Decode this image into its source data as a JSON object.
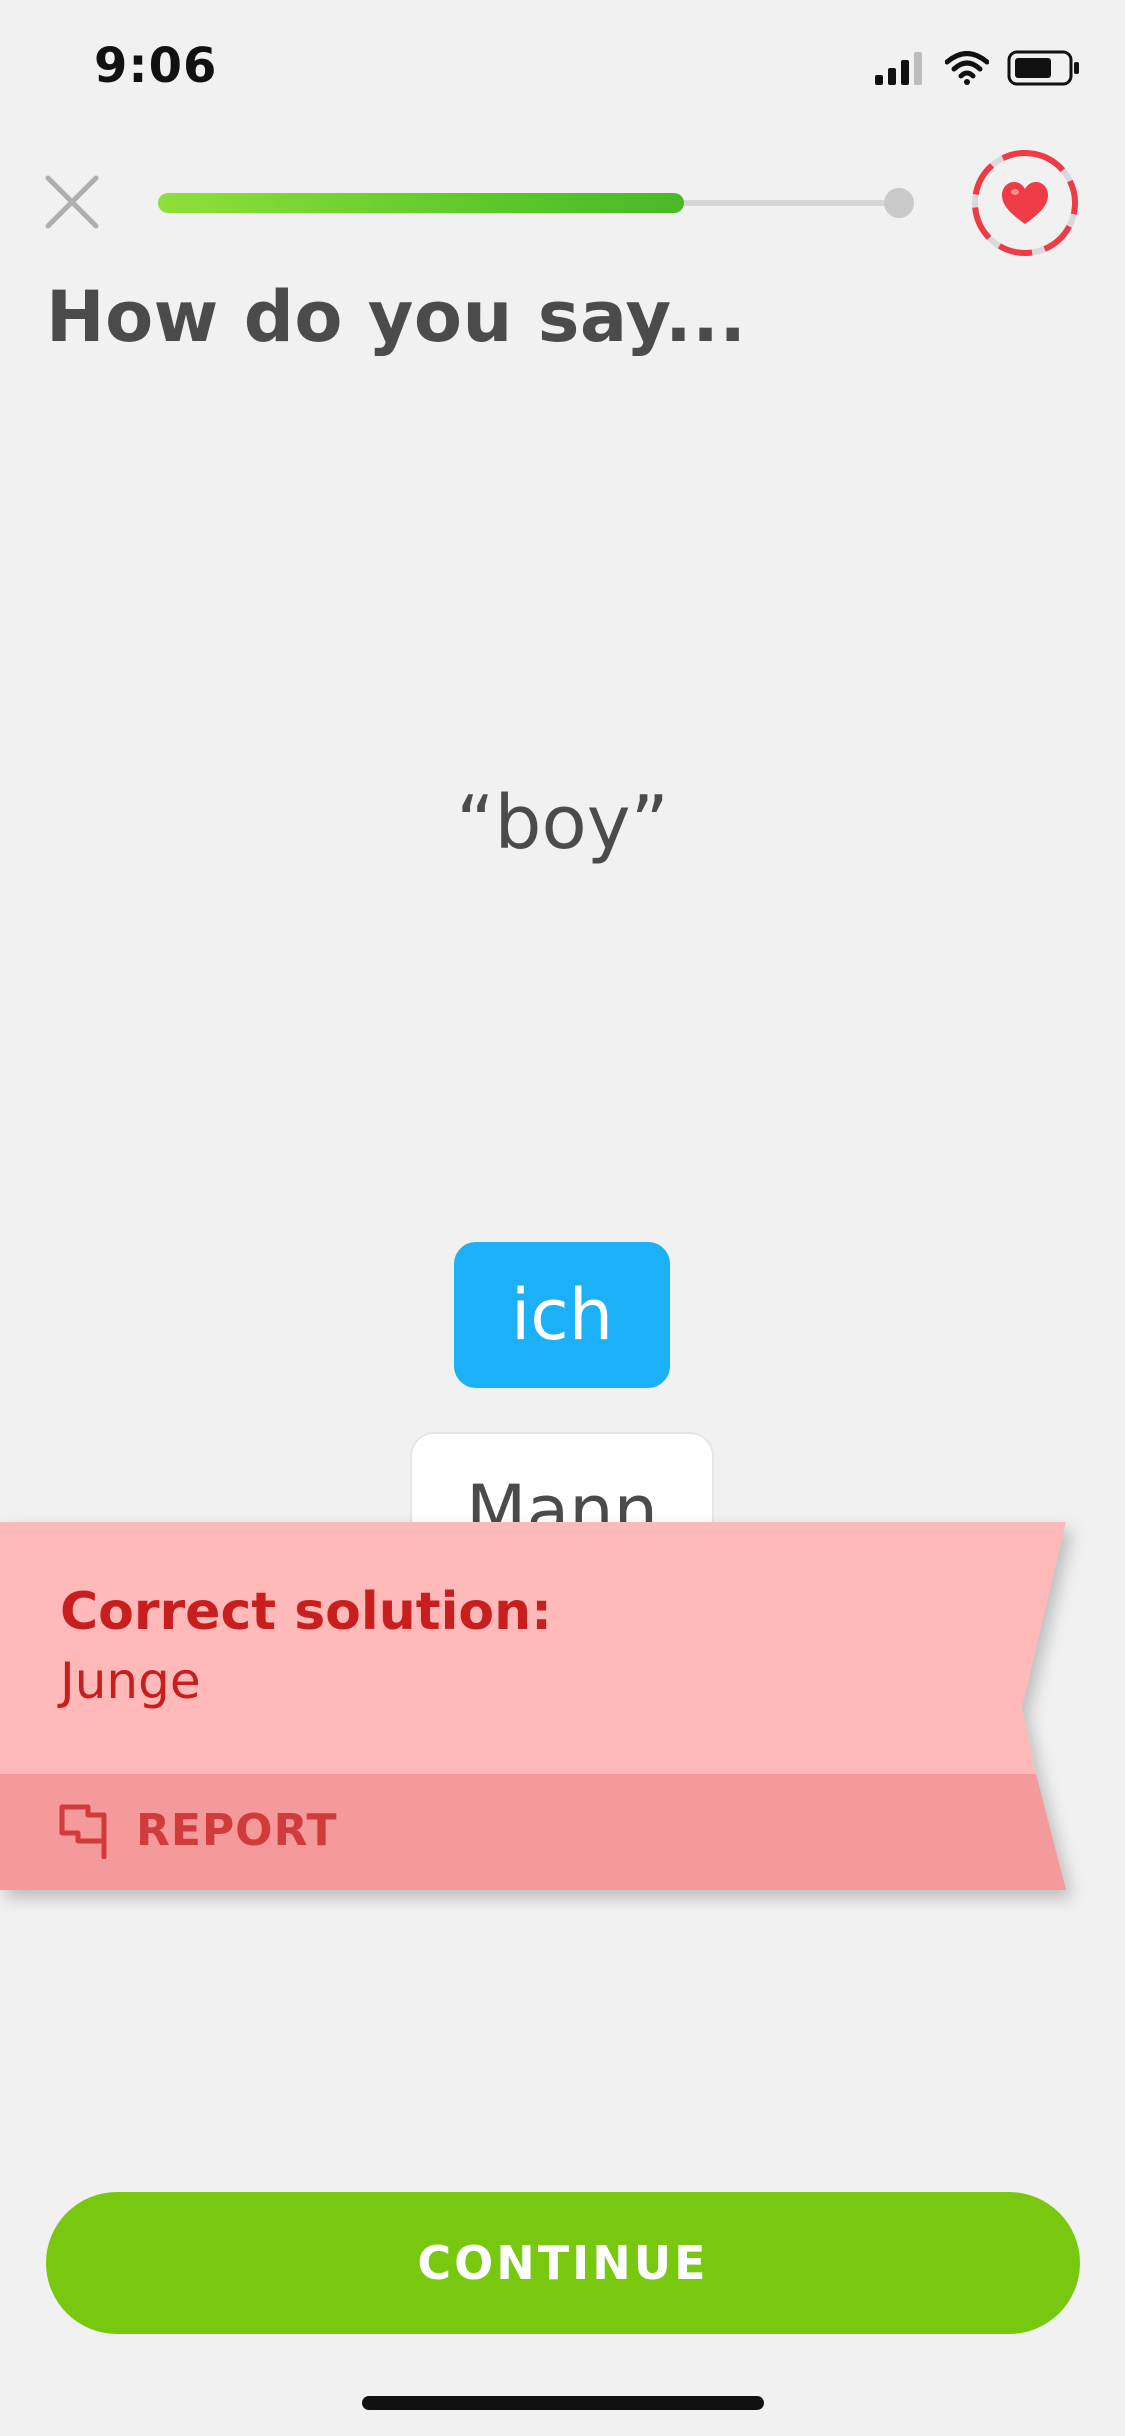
{
  "status_bar": {
    "time": "9:06"
  },
  "header": {
    "progress": 0.7
  },
  "prompt": {
    "title": "How do you say...",
    "word": "“boy”"
  },
  "answer": {
    "selected": "ich",
    "options": [
      "Mann"
    ]
  },
  "feedback": {
    "label": "Correct solution:",
    "solution": "Junge",
    "report_label": "REPORT"
  },
  "footer": {
    "continue_label": "CONTINUE"
  },
  "colors": {
    "progress_start": "#8ee03a",
    "progress_end": "#4cb828",
    "selected_chip": "#1cb0f6",
    "ribbon_light": "#ffb9b9",
    "ribbon_dark": "#f59a9a",
    "error_text": "#c81e1e",
    "continue": "#78c80f",
    "heart": "#ee3b45"
  },
  "icons": {
    "close": "close-icon",
    "heart": "heart-icon",
    "report": "flag-icon",
    "signal": "signal-icon",
    "wifi": "wifi-icon",
    "battery": "battery-icon"
  }
}
